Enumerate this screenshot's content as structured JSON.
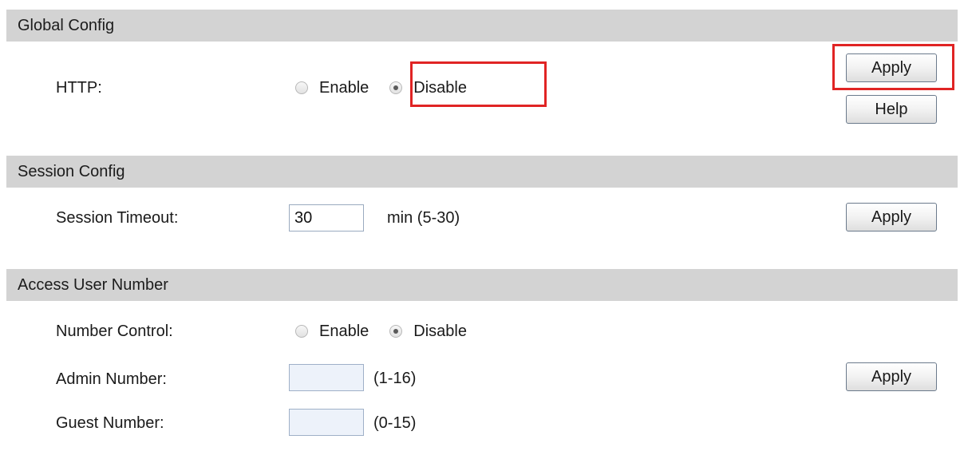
{
  "global_config": {
    "header": "Global Config",
    "http_label": "HTTP:",
    "options": [
      "Enable",
      "Disable"
    ],
    "selected": "Disable",
    "apply_label": "Apply",
    "help_label": "Help"
  },
  "session_config": {
    "header": "Session Config",
    "timeout_label": "Session Timeout:",
    "timeout_value": "30",
    "timeout_hint": "min (5-30)",
    "apply_label": "Apply"
  },
  "access_user_number": {
    "header": "Access User Number",
    "number_control_label": "Number Control:",
    "options": [
      "Enable",
      "Disable"
    ],
    "selected": "Disable",
    "admin_label": "Admin Number:",
    "admin_value": "",
    "admin_hint": "(1-16)",
    "guest_label": "Guest Number:",
    "guest_value": "",
    "guest_hint": "(0-15)",
    "apply_label": "Apply"
  },
  "colors": {
    "section_header_bg": "#d3d3d3",
    "highlight": "#e02424"
  }
}
